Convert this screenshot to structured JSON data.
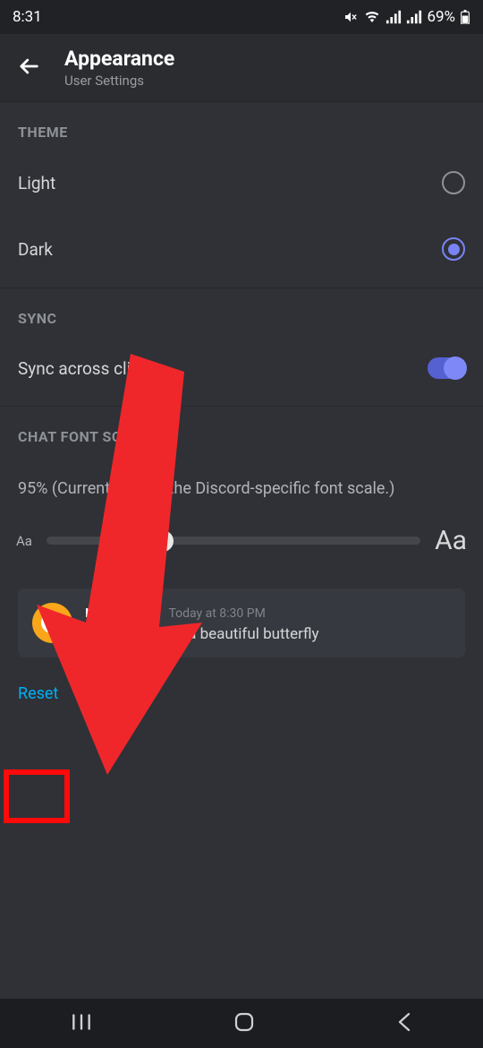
{
  "status_bar": {
    "time": "8:31",
    "battery": "69%"
  },
  "header": {
    "title": "Appearance",
    "subtitle": "User Settings"
  },
  "sections": {
    "theme": {
      "header": "THEME",
      "options": {
        "light": "Light",
        "dark": "Dark"
      }
    },
    "sync": {
      "header": "SYNC",
      "label": "Sync across clients"
    },
    "font_scaling": {
      "header": "CHAT FONT SCALING",
      "description": "95% (Currently using the Discord-specific font scale.)",
      "small_aa": "Aa",
      "large_aa": "Aa"
    }
  },
  "preview": {
    "username": "moinzisun",
    "timestamp": "Today at 8:30 PM",
    "message": "Look at me I'm a beautiful butterfly"
  },
  "reset_label": "Reset"
}
